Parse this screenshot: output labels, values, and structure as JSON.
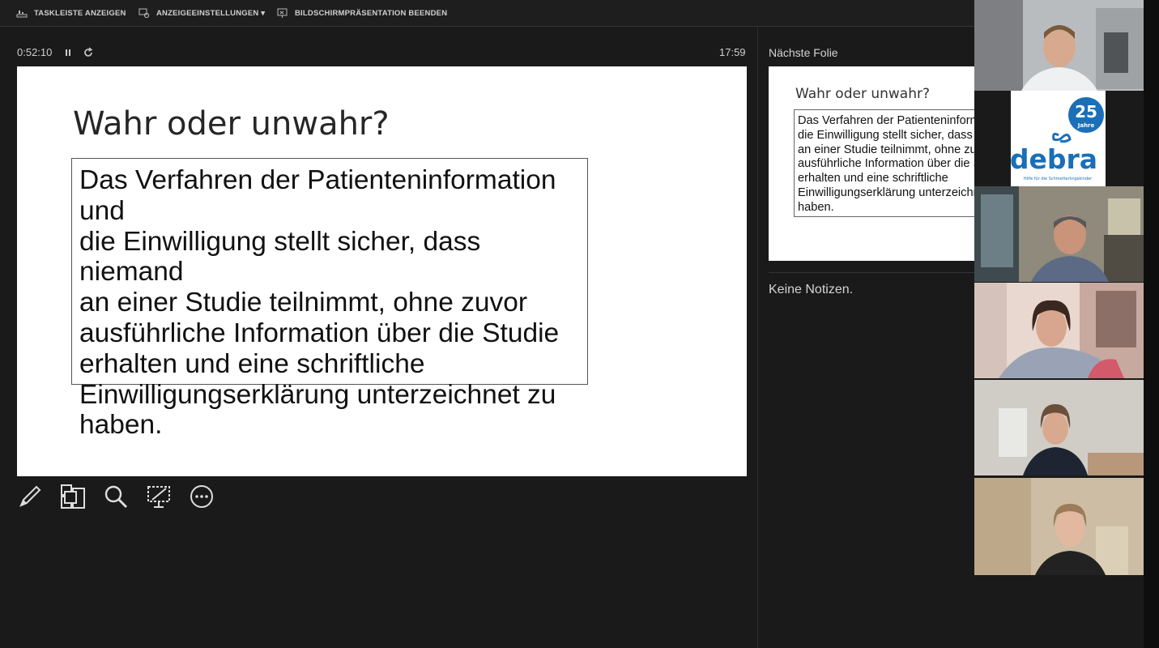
{
  "toolbar": {
    "taskbar": "TASKLEISTE ANZEIGEN",
    "display_settings": "ANZEIGEEINSTELLUNGEN ▾",
    "end_show": "BILDSCHIRMPRÄSENTATION BEENDEN"
  },
  "presenter": {
    "elapsed": "0:52:10",
    "clock": "17:59"
  },
  "slide": {
    "title": "Wahr oder unwahr?",
    "lines": [
      "Das Verfahren der Patienteninformation und",
      "die Einwilligung stellt sicher, dass niemand",
      "an einer Studie teilnimmt, ohne zuvor",
      "ausführliche Information über die Studie",
      "erhalten und eine schriftliche",
      "Einwilligungserklärung unterzeichnet zu",
      "haben."
    ]
  },
  "next": {
    "label": "Nächste Folie",
    "title": "Wahr oder unwahr?",
    "lines": [
      "Das Verfahren der Patienteninformation und",
      "die Einwilligung stellt sicher, dass niemand",
      "an einer Studie teilnimmt, ohne zuvor",
      "ausführliche Information über die Studie",
      "erhalten und eine schriftliche",
      "Einwilligungserklärung unterzeichnet zu",
      "haben."
    ]
  },
  "notes": "Keine Notizen.",
  "logo": {
    "text": "debra",
    "badge": "25",
    "badge_sub": "Jahre",
    "tagline": "Hilfe für die Schmetterlingskinder"
  },
  "colors": {
    "accent": "#1a6fb8",
    "background": "#1a1a1a"
  },
  "icons": [
    "taskbar-icon",
    "display-settings-icon",
    "end-show-icon",
    "pause-icon",
    "reset-icon",
    "pen-icon",
    "slides-grid-icon",
    "zoom-icon",
    "screen-icon",
    "more-options-icon"
  ]
}
